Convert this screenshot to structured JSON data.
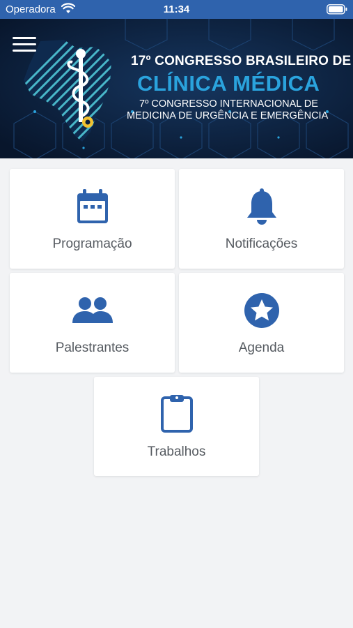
{
  "status_bar": {
    "carrier": "Operadora",
    "time": "11:34",
    "wifi_icon": "wifi-icon",
    "battery_icon": "battery-icon"
  },
  "banner": {
    "line1": "17º CONGRESSO BRASILEIRO DE",
    "line2": "CLÍNICA MÉDICA",
    "line3": "7º CONGRESSO INTERNACIONAL DE",
    "line4": "MEDICINA DE URGÊNCIA E EMERGÊNCIA",
    "menu_icon": "hamburger-menu-icon",
    "logo_icon": "caduceus-brazil-map-icon"
  },
  "menu": [
    {
      "label": "Programação",
      "icon": "calendar-icon"
    },
    {
      "label": "Notificações",
      "icon": "bell-icon"
    },
    {
      "label": "Palestrantes",
      "icon": "people-icon"
    },
    {
      "label": "Agenda",
      "icon": "star-circle-icon"
    },
    {
      "label": "Trabalhos",
      "icon": "clipboard-icon"
    }
  ],
  "colors": {
    "accent": "#2f63ad",
    "banner_bg": "#0c1e3a",
    "title_blue": "#2aa3dd",
    "background": "#f2f3f5",
    "label_gray": "#555a60"
  }
}
